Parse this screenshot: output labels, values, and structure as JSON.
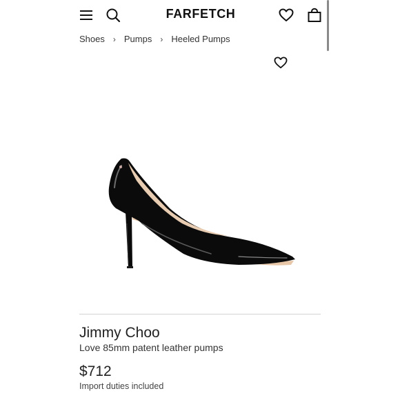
{
  "header": {
    "logo_text": "FARFETCH",
    "icons": [
      "menu-icon",
      "search-icon",
      "heart-icon",
      "shopping-bag-icon"
    ]
  },
  "breadcrumb": {
    "items": [
      "Shoes",
      "Pumps",
      "Heeled Pumps"
    ],
    "separator": "›"
  },
  "product": {
    "brand": "Jimmy Choo",
    "name": "Love 85mm patent leather pumps",
    "price": "$712",
    "duties_note": "Import duties included",
    "image": "black patent leather pointed-toe pump"
  },
  "colors": {
    "text": "#222222",
    "divider": "#d2d2d2",
    "shoe": "#0b0b0b",
    "lining": "#e9cdb2"
  }
}
